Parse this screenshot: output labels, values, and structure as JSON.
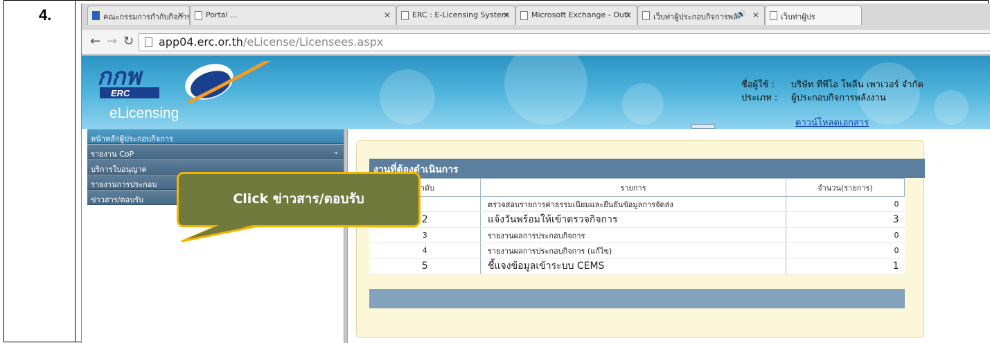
{
  "step": {
    "number": "4."
  },
  "tabs": [
    {
      "label": "คณะกรรมการกำกับกิจการพลั",
      "icon": "erc-logo-icon",
      "active": false
    },
    {
      "label": "Portal ...",
      "icon": "page-icon",
      "active": false
    },
    {
      "label": "ERC : E-Licensing System",
      "icon": "page-icon",
      "active": false
    },
    {
      "label": "Microsoft Exchange - Outl",
      "icon": "page-icon",
      "active": false
    },
    {
      "label": "เว็บท่าผู้ประกอบกิจการพลั",
      "icon": "page-icon",
      "active": false
    },
    {
      "label": "เว็บท่าผู้ปร",
      "icon": "page-icon",
      "active": true
    }
  ],
  "address": {
    "domain": "app04.erc.or.th",
    "path": "/eLicense/Licensees.aspx"
  },
  "header": {
    "brand": "eLicensing",
    "user_label": "ชื่อผู้ใช้ :",
    "user_value": "บริษัท ทีพีไอ โพลีน เพาเวอร์ จำกัด",
    "type_label": "ประเภท :",
    "type_value": "ผู้ประกอบกิจการพลังงาน",
    "download_link": "ดาวน์โหลดเอกสาร"
  },
  "sidebar": {
    "items": [
      {
        "label": "หน้าหลักผู้ประกอบกิจการ",
        "expandable": false
      },
      {
        "label": "รายงาน CoP",
        "expandable": true
      },
      {
        "label": "บริการใบอนุญาต",
        "expandable": false
      },
      {
        "label": "รายงานการประกอบ",
        "expandable": false
      },
      {
        "label": "ข่าวสาร/ตอบรับ",
        "expandable": false
      }
    ]
  },
  "tasks": {
    "title": "งานที่ต้องดำเนินการ",
    "columns": [
      "ลำดับ",
      "รายการ",
      "จำนวน(รายการ)"
    ],
    "rows": [
      {
        "no": "",
        "item": "ตรวจสอบรายการค่าธรรมเนียมและยืนยันข้อมูลการจัดส่ง",
        "count": "0"
      },
      {
        "no": "2",
        "item": "แจ้งวันพร้อมให้เข้าตรวจกิจการ",
        "count": "3"
      },
      {
        "no": "3",
        "item": "รายงานผลการประกอบกิจการ",
        "count": "0"
      },
      {
        "no": "4",
        "item": "รายงานผลการประกอบกิจการ (แก้ไข)",
        "count": "0"
      },
      {
        "no": "5",
        "item": "ชี้แจงข้อมูลเข้าระบบ CEMS",
        "count": "1"
      }
    ]
  },
  "callout": {
    "text": "Click ข่าวสาร/ตอบรับ"
  }
}
